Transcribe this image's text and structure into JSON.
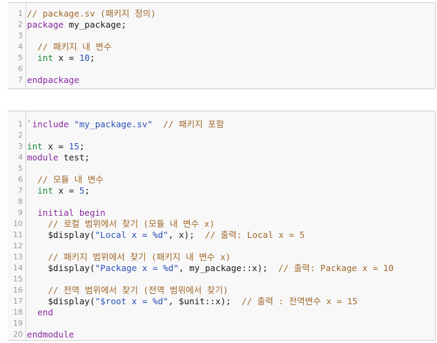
{
  "colors": {
    "comment": "#a0682a",
    "keyword": "#8a2aa0",
    "type": "#1c8a3a",
    "string": "#2a50b8",
    "number": "#2a50b8",
    "plain": "#1a1a1a",
    "line_number": "#9a9a9a",
    "background": "#f8f8f8",
    "border": "#cfcfcf"
  },
  "code_blocks": [
    {
      "lines": [
        {
          "num": "1",
          "tokens": [
            {
              "t": "comment",
              "v": "// package.sv (패키지 정의)"
            }
          ]
        },
        {
          "num": "2",
          "tokens": [
            {
              "t": "keyword",
              "v": "package"
            },
            {
              "t": "plain",
              "v": " my_package;"
            }
          ]
        },
        {
          "num": "3",
          "tokens": []
        },
        {
          "num": "4",
          "tokens": [
            {
              "t": "plain",
              "v": "  "
            },
            {
              "t": "comment",
              "v": "// 패키지 내 변수"
            }
          ]
        },
        {
          "num": "5",
          "tokens": [
            {
              "t": "plain",
              "v": "  "
            },
            {
              "t": "type",
              "v": "int"
            },
            {
              "t": "plain",
              "v": " x = "
            },
            {
              "t": "number",
              "v": "10"
            },
            {
              "t": "plain",
              "v": ";"
            }
          ]
        },
        {
          "num": "6",
          "tokens": []
        },
        {
          "num": "7",
          "tokens": [
            {
              "t": "keyword",
              "v": "endpackage"
            }
          ]
        }
      ]
    },
    {
      "lines": [
        {
          "num": "1",
          "tokens": [
            {
              "t": "keyword",
              "v": "`include"
            },
            {
              "t": "plain",
              "v": " "
            },
            {
              "t": "string",
              "v": "\"my_package.sv\""
            },
            {
              "t": "plain",
              "v": "  "
            },
            {
              "t": "comment",
              "v": "// 패키지 포함"
            }
          ]
        },
        {
          "num": "2",
          "tokens": []
        },
        {
          "num": "3",
          "tokens": [
            {
              "t": "type",
              "v": "int"
            },
            {
              "t": "plain",
              "v": " x = "
            },
            {
              "t": "number",
              "v": "15"
            },
            {
              "t": "plain",
              "v": ";"
            }
          ]
        },
        {
          "num": "4",
          "tokens": [
            {
              "t": "keyword",
              "v": "module"
            },
            {
              "t": "plain",
              "v": " test;"
            }
          ]
        },
        {
          "num": "5",
          "tokens": []
        },
        {
          "num": "6",
          "tokens": [
            {
              "t": "plain",
              "v": "  "
            },
            {
              "t": "comment",
              "v": "// 모듈 내 변수"
            }
          ]
        },
        {
          "num": "7",
          "tokens": [
            {
              "t": "plain",
              "v": "  "
            },
            {
              "t": "type",
              "v": "int"
            },
            {
              "t": "plain",
              "v": " x = "
            },
            {
              "t": "number",
              "v": "5"
            },
            {
              "t": "plain",
              "v": ";"
            }
          ]
        },
        {
          "num": "8",
          "tokens": []
        },
        {
          "num": "9",
          "tokens": [
            {
              "t": "plain",
              "v": "  "
            },
            {
              "t": "keyword",
              "v": "initial"
            },
            {
              "t": "plain",
              "v": " "
            },
            {
              "t": "keyword",
              "v": "begin"
            }
          ]
        },
        {
          "num": "10",
          "tokens": [
            {
              "t": "plain",
              "v": "    "
            },
            {
              "t": "comment",
              "v": "// 로컬 범위에서 찾기 (모듈 내 변수 x)"
            }
          ]
        },
        {
          "num": "11",
          "tokens": [
            {
              "t": "plain",
              "v": "    $display("
            },
            {
              "t": "string",
              "v": "\"Local x = %d\""
            },
            {
              "t": "plain",
              "v": ", x);  "
            },
            {
              "t": "comment",
              "v": "// 출력: Local x = 5"
            }
          ]
        },
        {
          "num": "12",
          "tokens": []
        },
        {
          "num": "13",
          "tokens": [
            {
              "t": "plain",
              "v": "    "
            },
            {
              "t": "comment",
              "v": "// 패키지 범위에서 찾기 (패키지 내 변수 x)"
            }
          ]
        },
        {
          "num": "14",
          "tokens": [
            {
              "t": "plain",
              "v": "    $display("
            },
            {
              "t": "string",
              "v": "\"Package x = %d\""
            },
            {
              "t": "plain",
              "v": ", my_package::x);  "
            },
            {
              "t": "comment",
              "v": "// 출력: Package x = 10"
            }
          ]
        },
        {
          "num": "15",
          "tokens": []
        },
        {
          "num": "16",
          "tokens": [
            {
              "t": "plain",
              "v": "    "
            },
            {
              "t": "comment",
              "v": "// 전역 범위에서 찾기 (전역 범위에서 찾기)"
            }
          ]
        },
        {
          "num": "17",
          "tokens": [
            {
              "t": "plain",
              "v": "    $display("
            },
            {
              "t": "string",
              "v": "\"$root x = %d\""
            },
            {
              "t": "plain",
              "v": ", $unit::x);  "
            },
            {
              "t": "comment",
              "v": "// 출력 : 전역변수 x = 15"
            }
          ]
        },
        {
          "num": "18",
          "tokens": [
            {
              "t": "plain",
              "v": "  "
            },
            {
              "t": "keyword",
              "v": "end"
            }
          ]
        },
        {
          "num": "19",
          "tokens": []
        },
        {
          "num": "20",
          "tokens": [
            {
              "t": "keyword",
              "v": "endmodule"
            }
          ]
        }
      ]
    }
  ]
}
